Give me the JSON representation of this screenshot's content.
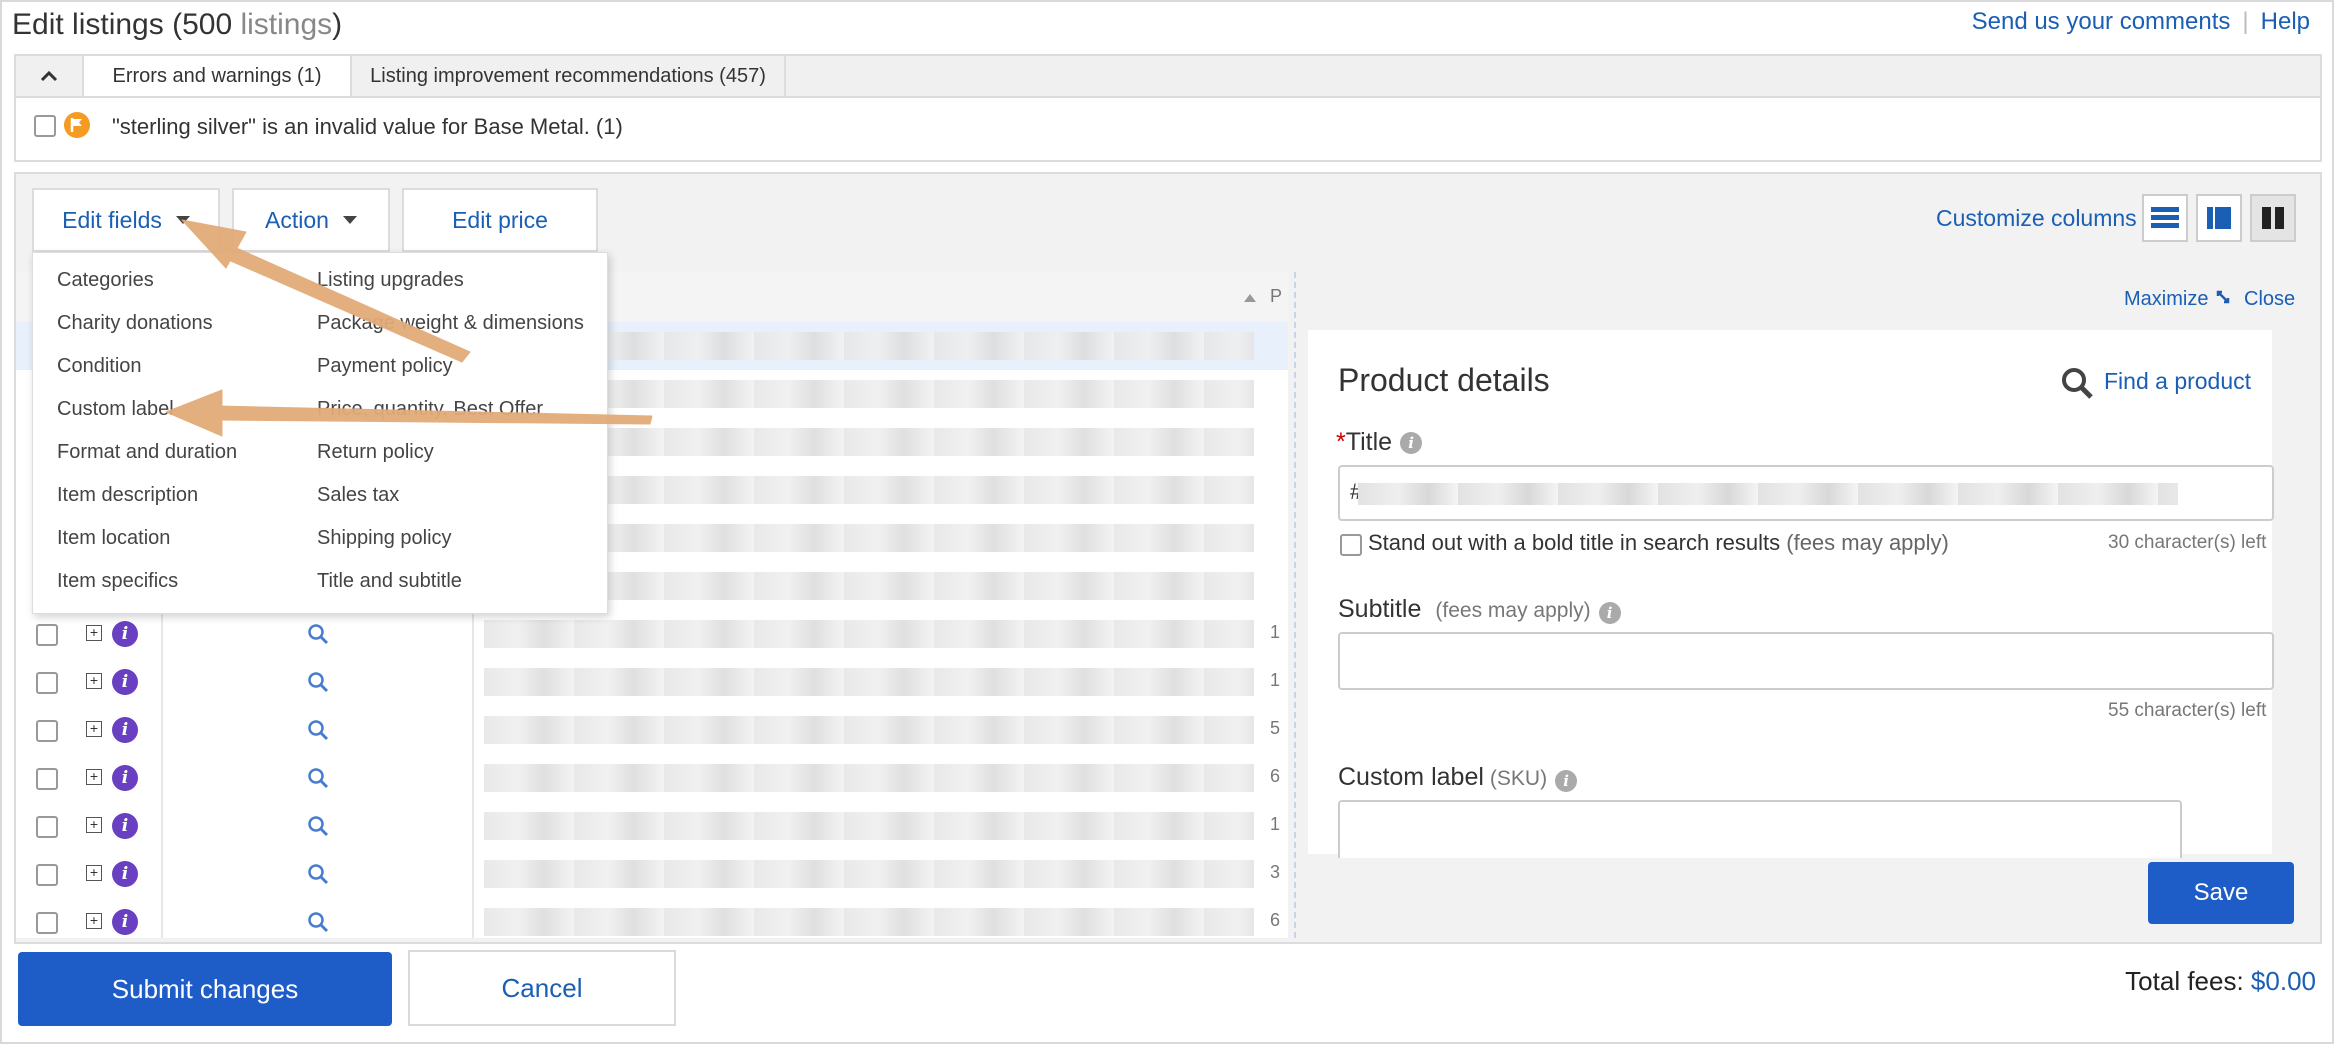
{
  "header": {
    "title": "Edit listings",
    "count_open": "(500 ",
    "count_word": "listings",
    "count_close": ")",
    "send_comments": "Send us your comments",
    "help": "Help",
    "separator": "|"
  },
  "tabs": {
    "collapse_icon": "chevron-up",
    "errors": "Errors and warnings (1)",
    "recommendations": "Listing improvement recommendations (457)"
  },
  "error_message": "\"sterling silver\" is an invalid value for Base Metal. (1)",
  "toolbar": {
    "edit_fields": "Edit fields",
    "action": "Action",
    "edit_price": "Edit price",
    "customize_columns": "Customize columns"
  },
  "edit_fields_menu": {
    "left": [
      "Categories",
      "Charity donations",
      "Condition",
      "Custom label",
      "Format and duration",
      "Item description",
      "Item location",
      "Item specifics"
    ],
    "right": [
      "Listing upgrades",
      "Package weight & dimensions",
      "Payment policy",
      "Price, quantity, Best Offer",
      "Return policy",
      "Sales tax",
      "Shipping policy",
      "Title and subtitle"
    ]
  },
  "table": {
    "header_cut": "P",
    "row_digits": [
      "1",
      "1",
      "5",
      "6",
      "1",
      "3",
      "6"
    ]
  },
  "detail": {
    "maximize": "Maximize",
    "close": "Close",
    "heading": "Product details",
    "find_product": "Find a product",
    "title_asterisk": "*",
    "title_label": "Title",
    "title_prefix": "#",
    "bold_label": "Stand out with a bold title in search results",
    "bold_fees": "(fees may apply)",
    "title_chars_left": "30 character(s) left",
    "subtitle_label": "Subtitle",
    "subtitle_fees": "(fees may apply)",
    "subtitle_chars_left": "55 character(s) left",
    "custom_label": "Custom label",
    "custom_label_suffix": "(SKU)",
    "save": "Save"
  },
  "footer": {
    "submit": "Submit changes",
    "cancel": "Cancel",
    "total_fees_label": "Total fees:",
    "total_fees_value": "$0.00"
  },
  "colors": {
    "primary_button": "#1e5cc8",
    "link": "#1a5fb4",
    "annotation_arrow": "#e2ab78",
    "info_badge": "#6a40c2",
    "warning_badge": "#f59a23"
  }
}
